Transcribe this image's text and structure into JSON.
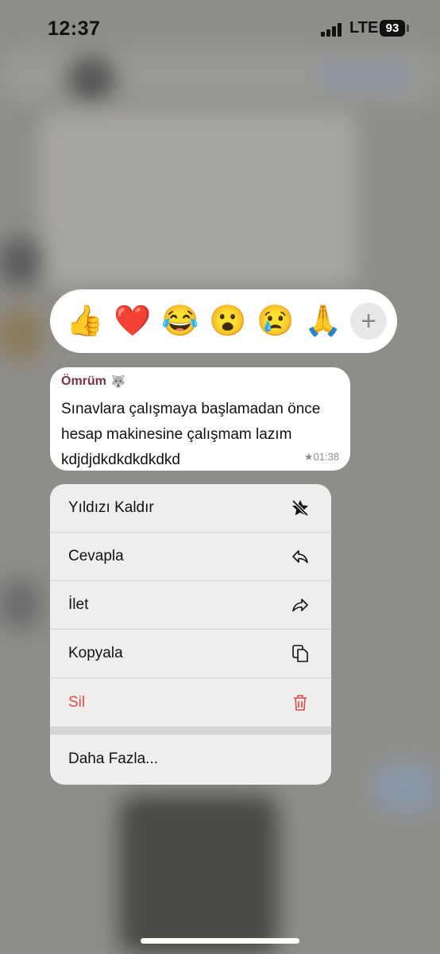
{
  "status_bar": {
    "time": "12:37",
    "network": "LTE",
    "battery": "93"
  },
  "reactions": [
    "👍",
    "❤️",
    "😂",
    "😮",
    "😢",
    "🙏"
  ],
  "reaction_add": "+",
  "message": {
    "sender": "Ömrüm",
    "sender_emoji": "🐺",
    "text": "Sınavlara çalışmaya başlamadan önce hesap makinesine çalışmam lazım kdjdjdkdkdkdkdkd",
    "time": "★01:38"
  },
  "menu": {
    "unstar": "Yıldızı Kaldır",
    "reply": "Cevapla",
    "forward": "İlet",
    "copy": "Kopyala",
    "delete": "Sil",
    "more": "Daha Fazla..."
  },
  "colors": {
    "danger": "#e24a43",
    "sender": "#7a3349"
  }
}
